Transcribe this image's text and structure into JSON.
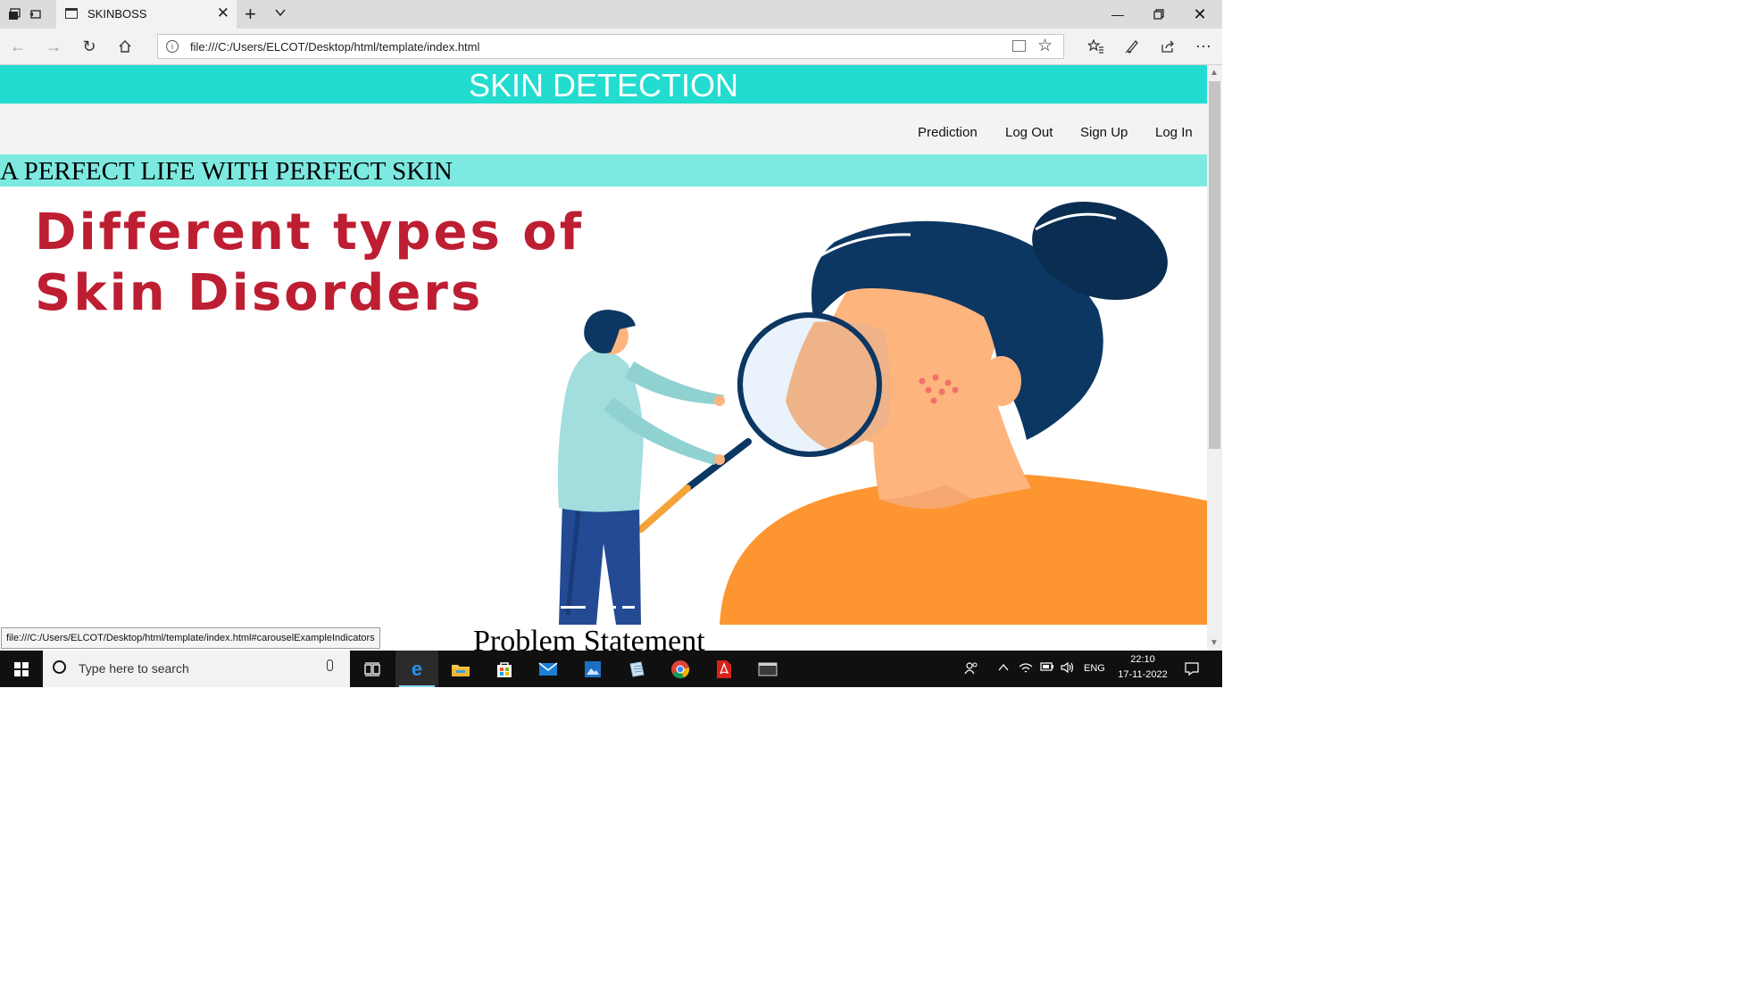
{
  "browser": {
    "tab_title": "SKINBOSS",
    "url": "file:///C:/Users/ELCOT/Desktop/html/template/index.html",
    "status_url": "file:///C:/Users/ELCOT/Desktop/html/template/index.html#carouselExampleIndicators"
  },
  "site": {
    "header_title": "SKIN DETECTION",
    "nav": [
      "Prediction",
      "Log Out",
      "Sign Up",
      "Log In"
    ],
    "tagline": "A PERFECT LIFE WITH PERFECT SKIN",
    "hero": {
      "heading_line1": "Different types of",
      "heading_line2": "Skin Disorders"
    },
    "section_heading": "Problem Statement"
  },
  "taskbar": {
    "search_placeholder": "Type here to search",
    "language": "ENG",
    "time": "22:10",
    "date": "17-11-2022"
  },
  "colors": {
    "header_teal": "#22dccf",
    "tagline_teal": "#7de9e1",
    "hero_heading": "#bd1e32",
    "hair_navy": "#0c3763",
    "skin": "#fdb47d",
    "shirt_orange": "#fd9531",
    "coat": "#a1dedd"
  },
  "icons": {
    "tab_bar": [
      "tab-actions-icon",
      "tabs-aside-icon",
      "page-icon",
      "close-icon",
      "new-tab-icon",
      "chevron-down-icon"
    ],
    "window": [
      "minimize-icon",
      "restore-icon",
      "close-icon"
    ],
    "nav": [
      "back-icon",
      "forward-icon",
      "refresh-icon",
      "home-icon",
      "info-icon",
      "reading-view-icon",
      "favorite-star-icon",
      "favorites-hub-icon",
      "pen-icon",
      "share-icon",
      "more-icon"
    ],
    "taskbar": [
      "windows-icon",
      "cortana-icon",
      "microphone-icon",
      "task-view-icon",
      "edge-icon",
      "file-explorer-icon",
      "store-icon",
      "mail-icon",
      "photos-icon",
      "notepad-icon",
      "chrome-icon",
      "acrobat-icon",
      "terminal-icon",
      "people-icon",
      "chevron-up-icon",
      "wifi-icon",
      "battery-icon",
      "volume-icon",
      "notification-icon"
    ]
  }
}
